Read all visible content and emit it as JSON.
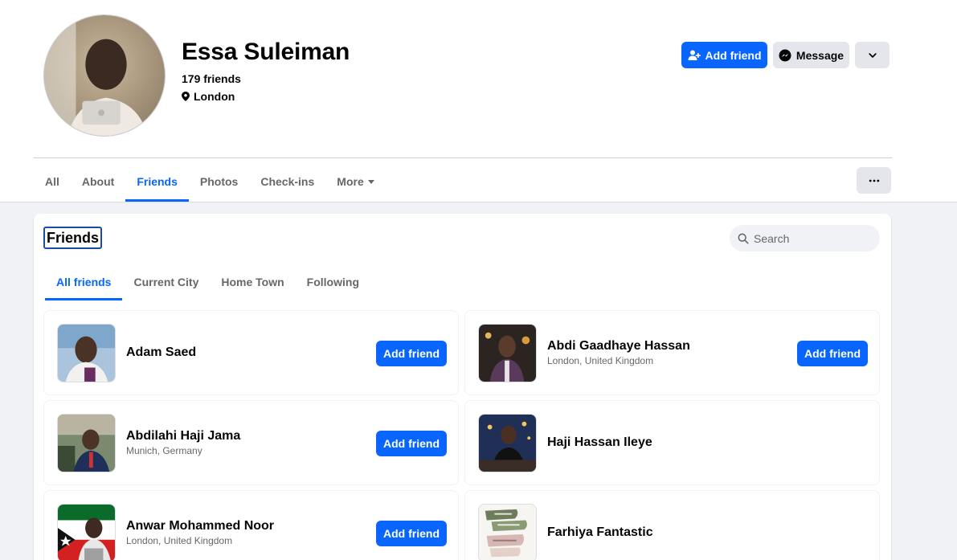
{
  "profile": {
    "name": "Essa Suleiman",
    "friends_count": "179 friends",
    "location": "London"
  },
  "actions": {
    "add_friend": "Add friend",
    "message": "Message"
  },
  "nav": {
    "tabs": [
      "All",
      "About",
      "Friends",
      "Photos",
      "Check-ins",
      "More"
    ],
    "active": "Friends"
  },
  "friends_section": {
    "title": "Friends",
    "search_placeholder": "Search",
    "tabs": [
      "All friends",
      "Current City",
      "Home Town",
      "Following"
    ],
    "active_tab": "All friends"
  },
  "friends": [
    {
      "name": "Adam Saed",
      "location": "",
      "button": "Add friend"
    },
    {
      "name": "Abdi Gaadhaye Hassan",
      "location": "London, United Kingdom",
      "button": "Add friend"
    },
    {
      "name": "Abdilahi Haji Jama",
      "location": "Munich, Germany",
      "button": "Add friend"
    },
    {
      "name": "Haji Hassan Ileye",
      "location": "",
      "button": ""
    },
    {
      "name": "Anwar Mohammed Noor",
      "location": "London, United Kingdom",
      "button": "Add friend"
    },
    {
      "name": "Farhiya Fantastic",
      "location": "",
      "button": ""
    }
  ],
  "colors": {
    "accent": "#0866ff",
    "background": "#f0f2f5",
    "secondary_text": "#65676b",
    "button_gray": "#e4e6eb"
  }
}
